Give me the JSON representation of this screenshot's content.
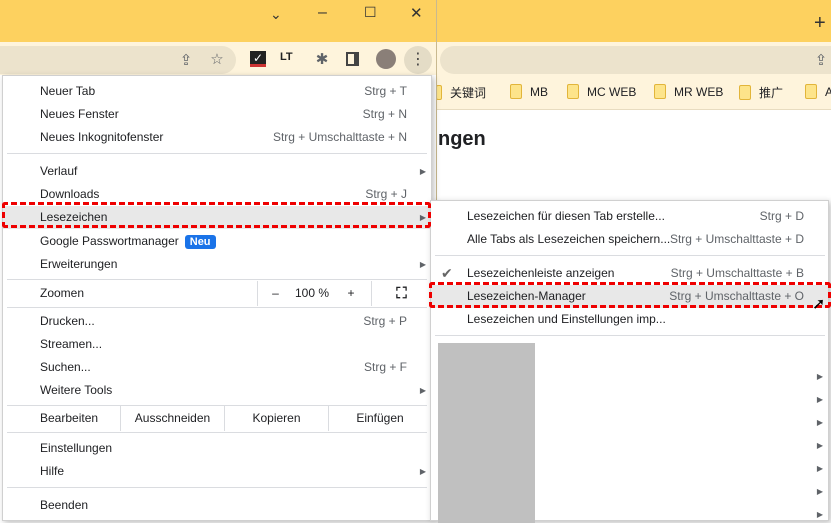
{
  "window": {
    "plus": "+",
    "chevron": "⌄",
    "minimize": "–",
    "maximize": "☐",
    "close": "✕"
  },
  "bookmarks_bar": [
    {
      "label": "关键词"
    },
    {
      "label": "MB"
    },
    {
      "label": "MC WEB"
    },
    {
      "label": "MR WEB"
    },
    {
      "label": "推广"
    },
    {
      "label": "A"
    }
  ],
  "page_heading": "ngen",
  "menu": {
    "items": [
      {
        "label": "Neuer Tab",
        "shortcut": "Strg + T"
      },
      {
        "label": "Neues Fenster",
        "shortcut": "Strg + N"
      },
      {
        "label": "Neues Inkognitofenster",
        "shortcut": "Strg + Umschalttaste + N"
      },
      {
        "label": "Verlauf"
      },
      {
        "label": "Downloads",
        "shortcut": "Strg + J"
      },
      {
        "label": "Lesezeichen"
      },
      {
        "label": "Google Passwortmanager",
        "badge": "Neu"
      },
      {
        "label": "Erweiterungen"
      },
      {
        "label": "Drucken...",
        "shortcut": "Strg + P"
      },
      {
        "label": "Streamen..."
      },
      {
        "label": "Suchen...",
        "shortcut": "Strg + F"
      },
      {
        "label": "Weitere Tools"
      },
      {
        "label": "Einstellungen"
      },
      {
        "label": "Hilfe"
      },
      {
        "label": "Beenden"
      }
    ],
    "zoom": {
      "label": "Zoomen",
      "minus": "–",
      "value": "100 %",
      "plus": "+"
    },
    "edit": {
      "label": "Bearbeiten",
      "cut": "Ausschneiden",
      "copy": "Kopieren",
      "paste": "Einfügen"
    }
  },
  "submenu": {
    "items": [
      {
        "label": "Lesezeichen für diesen Tab erstelle...",
        "shortcut": "Strg + D"
      },
      {
        "label": "Alle Tabs als Lesezeichen speichern...",
        "shortcut": "Strg + Umschalttaste + D"
      },
      {
        "label": "Lesezeichenleiste anzeigen",
        "shortcut": "Strg + Umschalttaste + B",
        "checked": true
      },
      {
        "label": "Lesezeichen-Manager",
        "shortcut": "Strg + Umschalttaste + O"
      },
      {
        "label": "Lesezeichen und Einstellungen imp..."
      }
    ]
  },
  "colors": {
    "highlight": "#e00000",
    "badge": "#1a73e8",
    "titlebar": "#fdd15f"
  }
}
